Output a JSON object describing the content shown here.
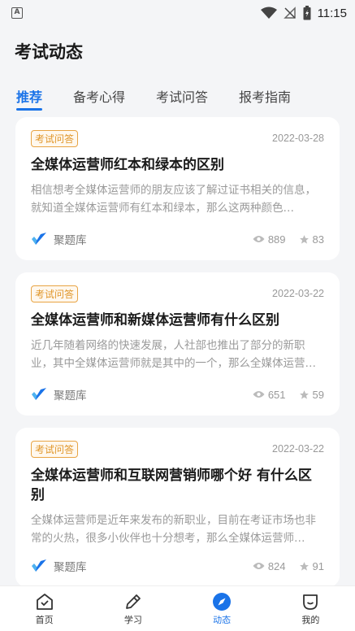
{
  "status": {
    "time": "11:15",
    "app_icon_letter": "A"
  },
  "header": {
    "title": "考试动态"
  },
  "tabs": [
    {
      "label": "推荐",
      "active": true
    },
    {
      "label": "备考心得",
      "active": false
    },
    {
      "label": "考试问答",
      "active": false
    },
    {
      "label": "报考指南",
      "active": false
    }
  ],
  "articles": [
    {
      "badge": "考试问答",
      "date": "2022-03-28",
      "title": "全媒体运营师红本和绿本的区别",
      "desc": "相信想考全媒体运营师的朋友应该了解过证书相关的信息，就知道全媒体运营师有红本和绿本，那么这两种颜色…",
      "source": "聚题库",
      "views": "889",
      "stars": "83"
    },
    {
      "badge": "考试问答",
      "date": "2022-03-22",
      "title": "全媒体运营师和新媒体运营师有什么区别",
      "desc": "近几年随着网络的快速发展，人社部也推出了部分的新职业，其中全媒体运营师就是其中的一个，那么全媒体运营…",
      "source": "聚题库",
      "views": "651",
      "stars": "59"
    },
    {
      "badge": "考试问答",
      "date": "2022-03-22",
      "title": "全媒体运营师和互联网营销师哪个好 有什么区别",
      "desc": "全媒体运营师是近年来发布的新职业，目前在考证市场也非常的火热，很多小伙伴也十分想考，那么全媒体运营师…",
      "source": "聚题库",
      "views": "824",
      "stars": "91"
    }
  ],
  "nav": [
    {
      "label": "首页",
      "icon": "home-icon"
    },
    {
      "label": "学习",
      "icon": "pencil-icon"
    },
    {
      "label": "动态",
      "icon": "compass-icon"
    },
    {
      "label": "我的",
      "icon": "profile-icon"
    }
  ],
  "colors": {
    "accent": "#1a73e8",
    "badge": "#e0962a",
    "background": "#f4f5f7"
  }
}
